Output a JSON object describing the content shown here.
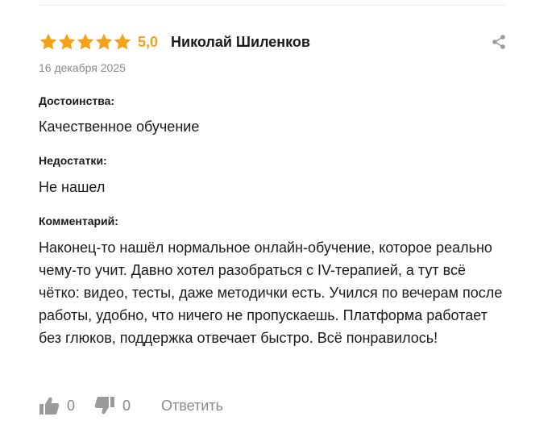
{
  "review": {
    "rating": 5,
    "rating_label": "5,0",
    "author": "Николай Шиленков",
    "date": "16 декабря 2025",
    "sections": {
      "pros_label": "Достоинства:",
      "pros_text": "Качественное обучение",
      "cons_label": "Недостатки:",
      "cons_text": "Не нашел",
      "comment_label": "Комментарий:",
      "comment_text": "Наконец-то нашёл нормальное онлайн-обучение, которое реально чему-то учит. Давно хотел разобраться с IV-терапией, а тут всё чётко: видео, тесты, даже методички есть. Учился по вечерам после работы, удобно, что ничего не пропускаешь. Платформа работает без глюков, поддержка отвечает быстро. Всё понравилось!"
    },
    "actions": {
      "likes": "0",
      "dislikes": "0",
      "reply_label": "Ответить"
    }
  },
  "colors": {
    "star": "#f6a11a",
    "muted": "#8a8a8a",
    "text": "#1a1a1a",
    "icon": "#9a9a9a"
  },
  "icons": [
    "star-icon",
    "share-icon",
    "thumbs-up-icon",
    "thumbs-down-icon"
  ]
}
